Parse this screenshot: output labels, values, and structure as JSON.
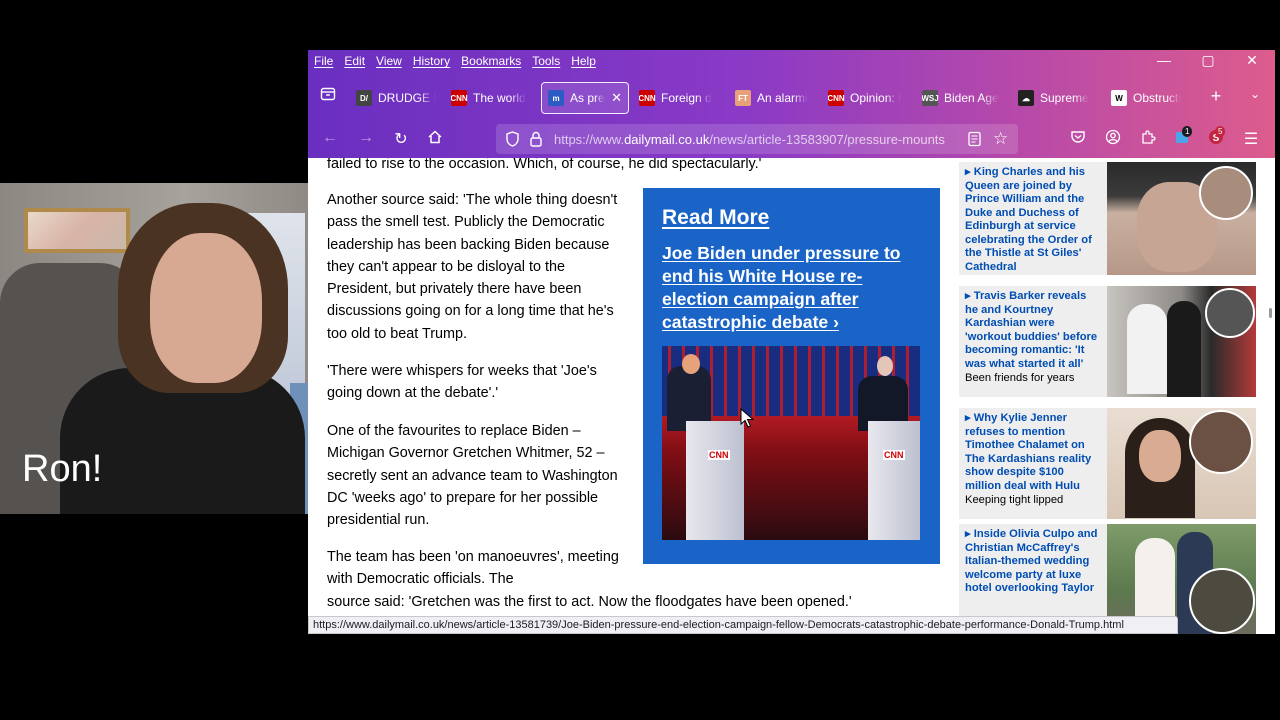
{
  "webcam": {
    "label": "Ron!"
  },
  "menu": [
    "File",
    "Edit",
    "View",
    "History",
    "Bookmarks",
    "Tools",
    "Help"
  ],
  "window_controls": {
    "minimize": "—",
    "maximize": "▢",
    "close": "✕"
  },
  "tabs": [
    {
      "title": "DRUDGE R",
      "fav": "D/",
      "fav_color": "#444444"
    },
    {
      "title": "The world",
      "fav": "CNN",
      "fav_color": "#cc0000"
    },
    {
      "title": "As pres",
      "fav": "m",
      "fav_color": "#2c5bc4",
      "active": true
    },
    {
      "title": "Foreign d",
      "fav": "CNN",
      "fav_color": "#cc0000"
    },
    {
      "title": "An alarmi",
      "fav": "FT",
      "fav_color": "#e8a07a"
    },
    {
      "title": "Opinion: I",
      "fav": "CNN",
      "fav_color": "#cc0000"
    },
    {
      "title": "Biden Age",
      "fav": "WSJ",
      "fav_color": "#555555"
    },
    {
      "title": "Supreme",
      "fav": "☁",
      "fav_color": "#222222"
    },
    {
      "title": "Obstructi",
      "fav": "W",
      "fav_color": "#ffffff"
    }
  ],
  "url": {
    "prefix": "https://www.",
    "domain": "dailymail.co.uk",
    "path": "/news/article-13583907/pressure-mounts"
  },
  "badges": {
    "extensions": "1",
    "profile": "5"
  },
  "article": {
    "top_fragment": "failed to rise to the occasion. Which, of course, he did spectacularly.'",
    "paragraphs": [
      "Another source said: 'The whole thing doesn't pass the smell test. Publicly the Democratic leadership has been backing Biden because they can't appear to be disloyal to the President, but privately there have been discussions going on for a long time that he's too old to beat Trump.",
      "'There were whispers for weeks that 'Joe's going down at the debate'.'",
      "One of the favourites to replace Biden – Michigan Governor Gretchen Whitmer, 52 – secretly sent an advance team to Washington DC 'weeks ago' to prepare for her possible presidential run.",
      "The team has been 'on manoeuvres', meeting with Democratic officials. The"
    ],
    "last_line": "source said: 'Gretchen was the first to act. Now the floodgates have been opened.'"
  },
  "read_more": {
    "title": "Read More",
    "headline": "Joe Biden under pressure to end his White House re-election campaign after catastrophic debate",
    "chevron": "›",
    "logo": "CNN"
  },
  "sidebar": [
    {
      "headline": "King Charles and his Queen are joined by Prince William and the Duke and Duchess of Edinburgh at service celebrating the Order of the Thistle at St Giles' Cathedral",
      "sub": ""
    },
    {
      "headline": "Travis Barker reveals he and Kourtney Kardashian were 'workout buddies' before becoming romantic: 'It was what started it all'",
      "sub": "Been friends for years"
    },
    {
      "headline": "Why Kylie Jenner refuses to mention Timothee Chalamet on The Kardashians reality show despite $100 million deal with Hulu",
      "sub": "Keeping tight lipped"
    },
    {
      "headline": "Inside Olivia Culpo and Christian McCaffrey's Italian-themed wedding welcome party at luxe hotel overlooking Taylor",
      "sub": ""
    }
  ],
  "status_url": "https://www.dailymail.co.uk/news/article-13581739/Joe-Biden-pressure-end-election-campaign-fellow-Democrats-catastrophic-debate-performance-Donald-Trump.html"
}
